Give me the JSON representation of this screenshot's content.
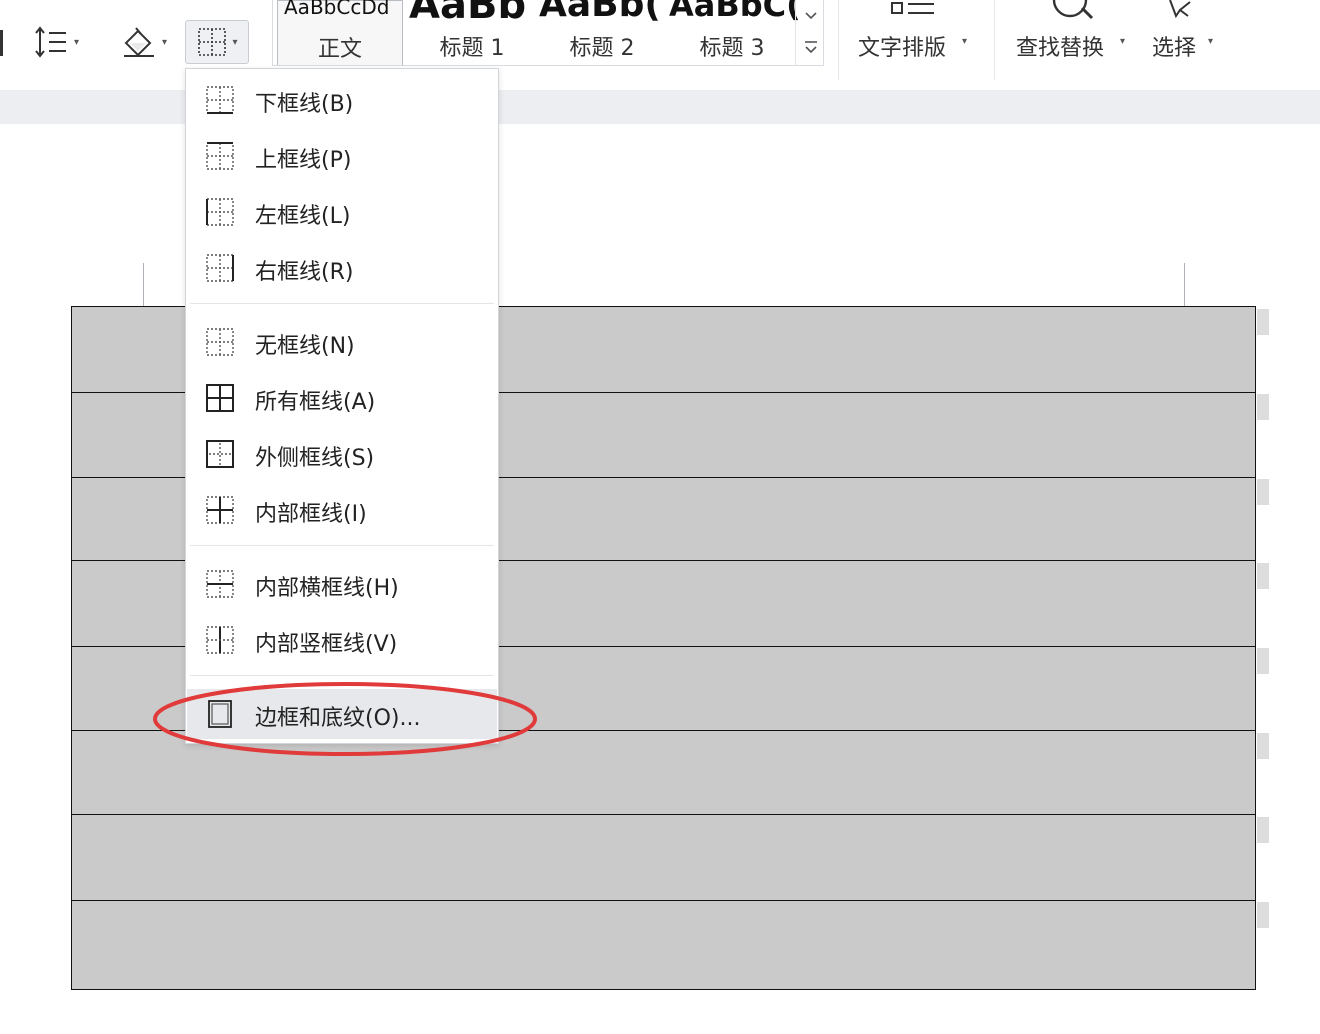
{
  "ribbon": {
    "style_gallery": [
      {
        "preview": "AaBbCcDd",
        "label": "正文",
        "selected": true
      },
      {
        "preview": "AaBb",
        "label": "标题 1"
      },
      {
        "preview": "AaBb(",
        "label": "标题 2"
      },
      {
        "preview": "AaBbC(",
        "label": "标题 3"
      }
    ],
    "text_layout_label": "文字排版",
    "find_replace_label": "查找替换",
    "select_label": "选择",
    "caret": "▾"
  },
  "border_menu": {
    "items": [
      {
        "label": "下框线(B)",
        "icon": "bottom-border-icon"
      },
      {
        "label": "上框线(P)",
        "icon": "top-border-icon"
      },
      {
        "label": "左框线(L)",
        "icon": "left-border-icon"
      },
      {
        "label": "右框线(R)",
        "icon": "right-border-icon"
      },
      {
        "label": "无框线(N)",
        "icon": "no-border-icon"
      },
      {
        "label": "所有框线(A)",
        "icon": "all-borders-icon"
      },
      {
        "label": "外侧框线(S)",
        "icon": "outside-borders-icon"
      },
      {
        "label": "内部框线(I)",
        "icon": "inside-borders-icon"
      },
      {
        "label": "内部横框线(H)",
        "icon": "inside-horizontal-border-icon"
      },
      {
        "label": "内部竖框线(V)",
        "icon": "inside-vertical-border-icon"
      },
      {
        "label": "边框和底纹(O)...",
        "icon": "borders-and-shading-icon",
        "highlighted": true
      }
    ]
  },
  "colors": {
    "accent_highlight": "#e03a3a",
    "table_fill": "#cacaca"
  }
}
